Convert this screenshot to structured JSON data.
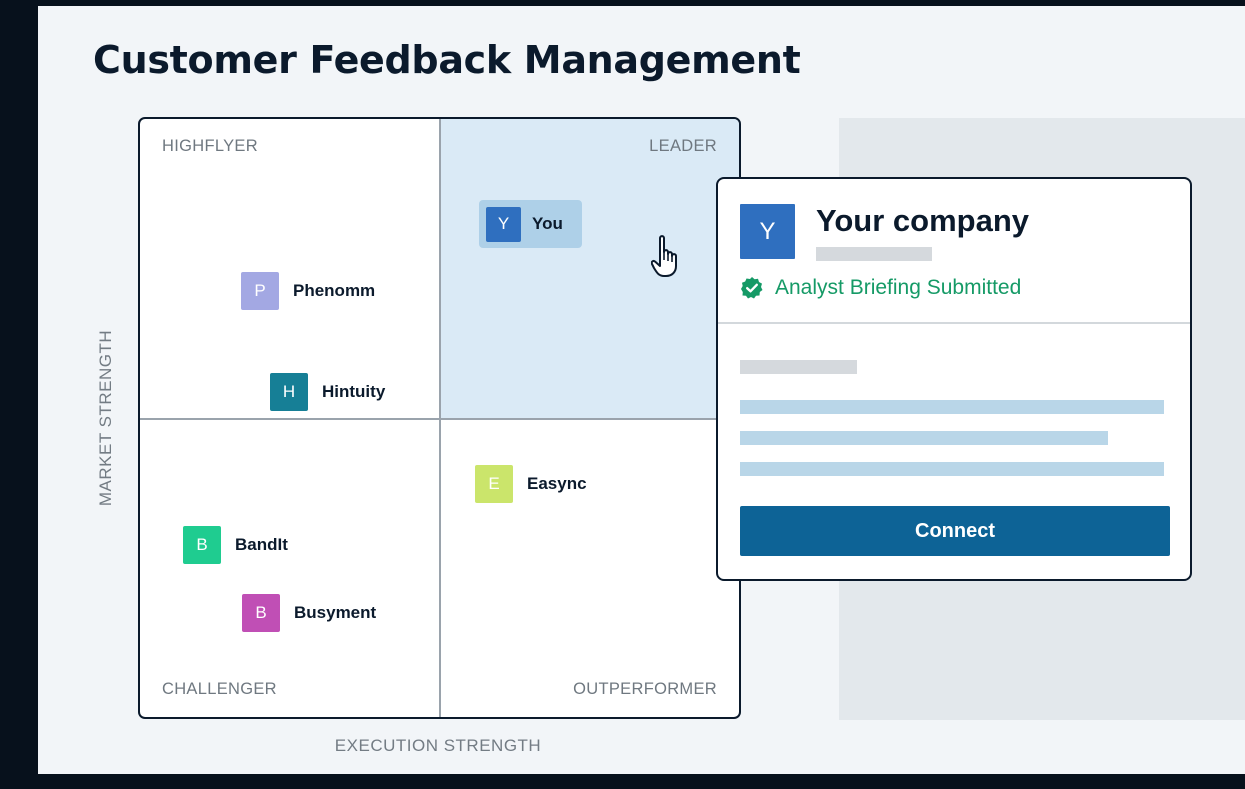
{
  "title": "Customer Feedback Management",
  "quadrants": {
    "top_left": "HIGHFLYER",
    "top_right": "LEADER",
    "bottom_left": "CHALLENGER",
    "bottom_right": "OUTPERFORMER"
  },
  "axes": {
    "y": "MARKET STRENGTH",
    "x": "EXECUTION STRENGTH"
  },
  "vendors": [
    {
      "letter": "P",
      "name": "Phenomm",
      "color": "#a3a8e3"
    },
    {
      "letter": "H",
      "name": "Hintuity",
      "color": "#167f96"
    },
    {
      "letter": "E",
      "name": "Easync",
      "color": "#cbe56b"
    },
    {
      "letter": "B",
      "name": "BandIt",
      "color": "#1fcc90"
    },
    {
      "letter": "B",
      "name": "Busyment",
      "color": "#c04fb5"
    }
  ],
  "you": {
    "letter": "Y",
    "name": "You",
    "color": "#2f6fbf"
  },
  "card": {
    "letter": "Y",
    "name": "Your company",
    "status": "Analyst Briefing Submitted",
    "button": "Connect"
  },
  "colors": {
    "leader_fill": "#daeaf6",
    "accent_green": "#159a66",
    "button": "#0d6396"
  },
  "icons": {
    "cursor": "hand-pointer-icon",
    "status": "verified-check-icon"
  }
}
